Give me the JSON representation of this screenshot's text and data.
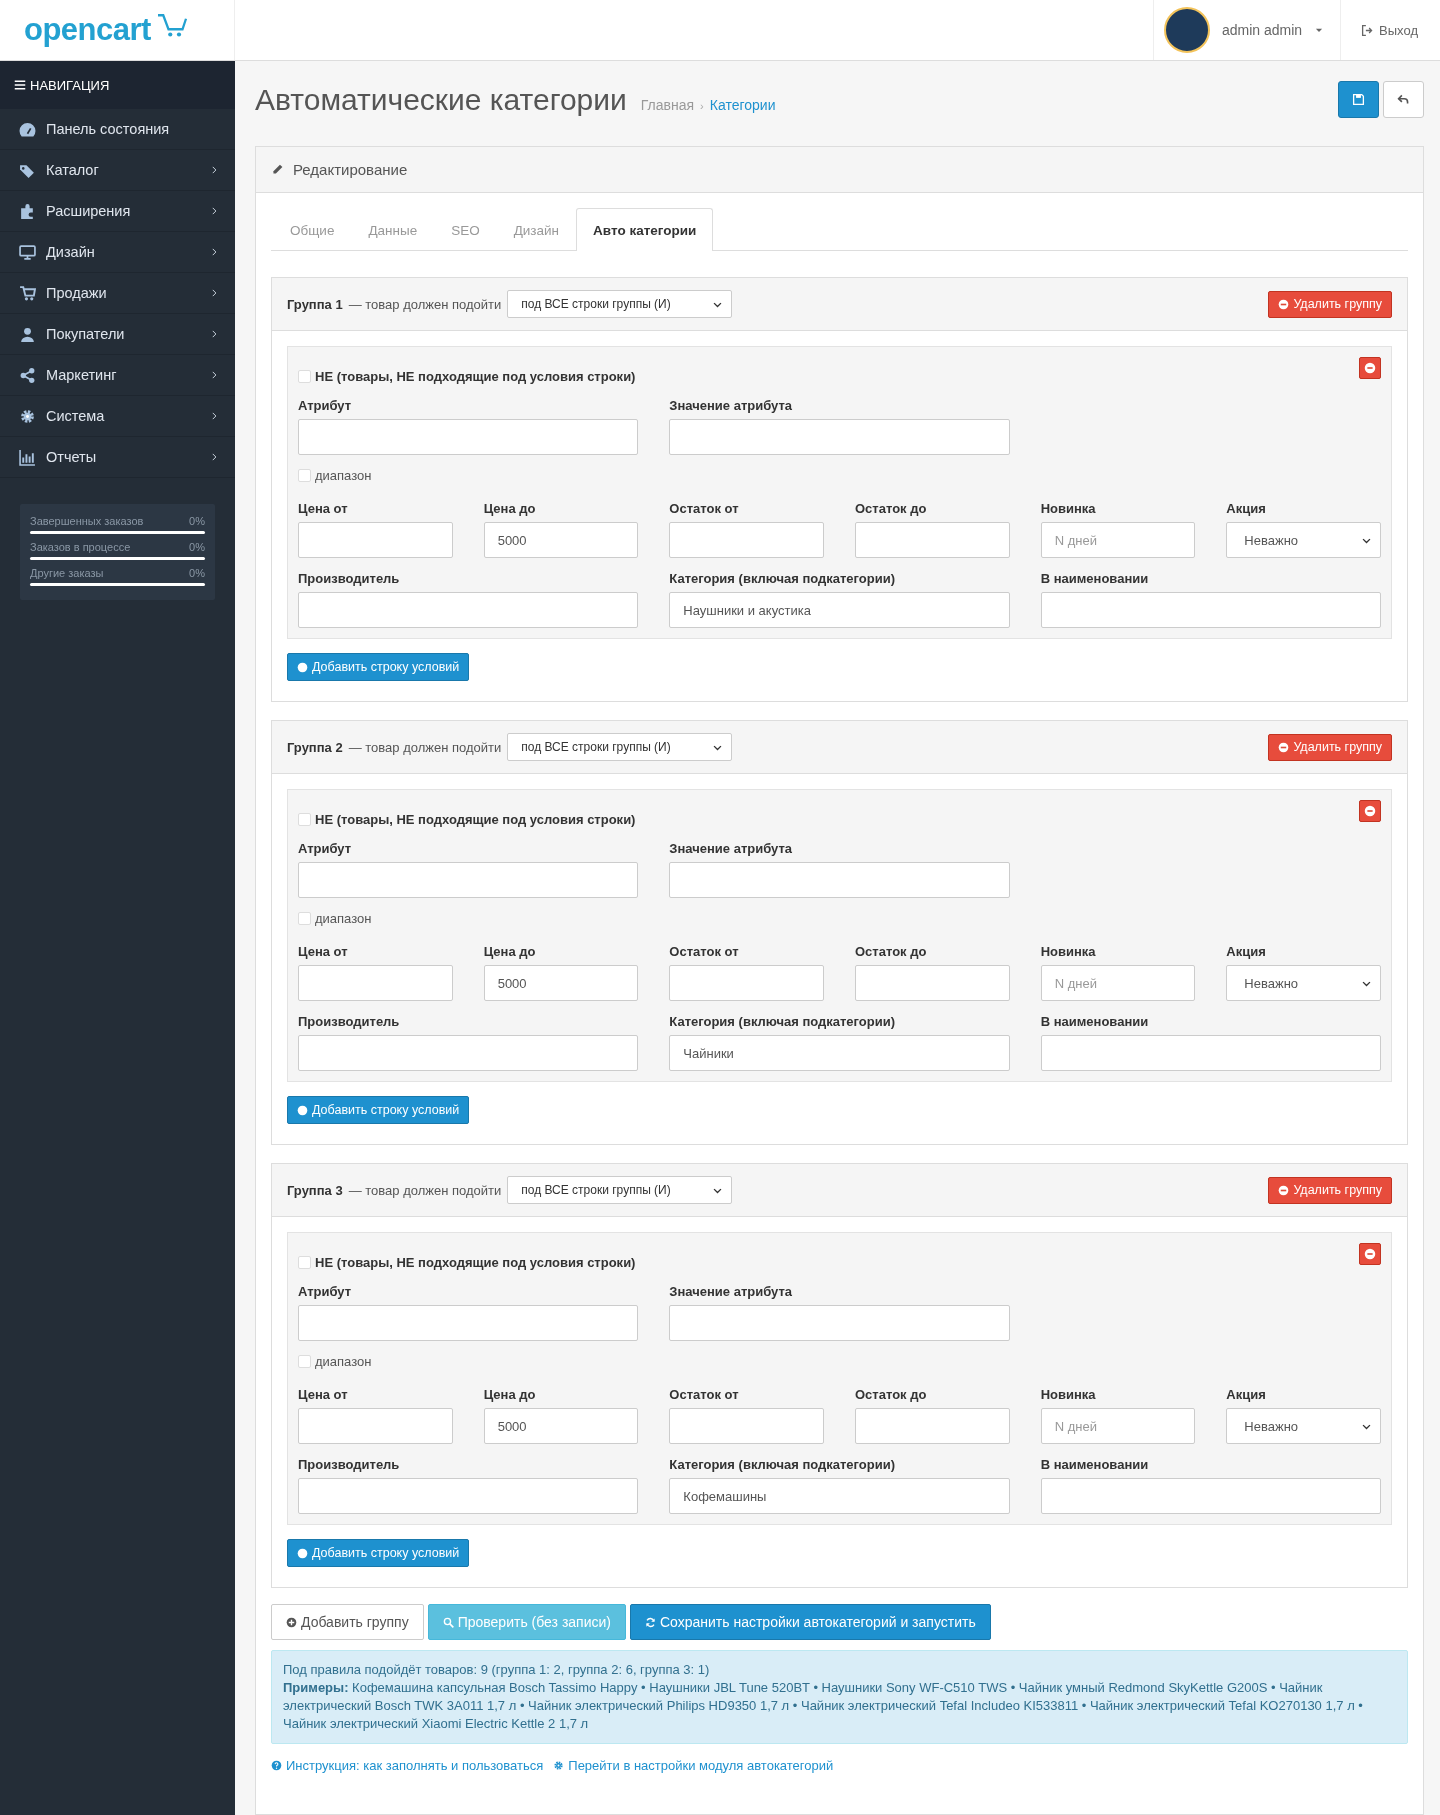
{
  "header": {
    "logo": "opencart",
    "user": "admin admin",
    "logout": "Выход"
  },
  "nav": {
    "title": "НАВИГАЦИЯ",
    "items": [
      {
        "label": "Панель состояния",
        "has_submenu": false
      },
      {
        "label": "Каталог",
        "has_submenu": true
      },
      {
        "label": "Расширения",
        "has_submenu": true
      },
      {
        "label": "Дизайн",
        "has_submenu": true
      },
      {
        "label": "Продажи",
        "has_submenu": true
      },
      {
        "label": "Покупатели",
        "has_submenu": true
      },
      {
        "label": "Маркетинг",
        "has_submenu": true
      },
      {
        "label": "Система",
        "has_submenu": true
      },
      {
        "label": "Отчеты",
        "has_submenu": true
      }
    ],
    "stats": [
      {
        "label": "Завершенных заказов",
        "value": "0%",
        "level": 0
      },
      {
        "label": "Заказов в процессе",
        "value": "0%",
        "level": 0
      },
      {
        "label": "Другие заказы",
        "value": "0%",
        "level": 0
      }
    ]
  },
  "page": {
    "title": "Автоматические категории",
    "separator": "›",
    "breadcrumbs": [
      {
        "label": "Главная",
        "link": false
      },
      {
        "label": "Категории",
        "link": true
      }
    ]
  },
  "panel": {
    "heading": "Редактирование",
    "tabs": [
      {
        "label": "Общие",
        "selected": false
      },
      {
        "label": "Данные",
        "selected": false
      },
      {
        "label": "SEO",
        "selected": false
      },
      {
        "label": "Дизайн",
        "selected": false
      },
      {
        "label": "Авто категории",
        "selected": true
      }
    ]
  },
  "groups": [
    {
      "title": "Группа 1",
      "note": "— товар должен подойти",
      "mode": "под ВСЕ строки группы (И)",
      "delete_label": "Удалить группу",
      "add_row_label": "Добавить строку условий",
      "rows": [
        {
          "negate": {
            "label": "НЕ (товары, НЕ подходящие под условия строки)",
            "checked": false
          },
          "attribute_fields": [
            {
              "kind": "text",
              "label": "Атрибут"
            },
            {
              "kind": "text",
              "label": "Значение атрибута"
            }
          ],
          "range": {
            "label": "диапазон",
            "checked": false
          },
          "filter_fields": [
            {
              "kind": "text",
              "label": "Цена от"
            },
            {
              "kind": "text",
              "label": "Цена до",
              "value": "5000"
            },
            {
              "kind": "text",
              "label": "Остаток от"
            },
            {
              "kind": "text",
              "label": "Остаток до"
            },
            {
              "kind": "text",
              "label": "Новинка",
              "placeholder": "N дней"
            },
            {
              "kind": "select",
              "label": "Акция",
              "value": "Неважно"
            }
          ],
          "detail_fields": [
            {
              "kind": "text",
              "label": "Производитель"
            },
            {
              "kind": "text",
              "label": "Категория (включая подкатегории)",
              "value": "Наушники и акустика"
            },
            {
              "kind": "text",
              "label": "В наименовании"
            }
          ]
        }
      ]
    },
    {
      "title": "Группа 2",
      "note": "— товар должен подойти",
      "mode": "под ВСЕ строки группы (И)",
      "delete_label": "Удалить группу",
      "add_row_label": "Добавить строку условий",
      "rows": [
        {
          "negate": {
            "label": "НЕ (товары, НЕ подходящие под условия строки)",
            "checked": false
          },
          "attribute_fields": [
            {
              "kind": "text",
              "label": "Атрибут"
            },
            {
              "kind": "text",
              "label": "Значение атрибута"
            }
          ],
          "range": {
            "label": "диапазон",
            "checked": false
          },
          "filter_fields": [
            {
              "kind": "text",
              "label": "Цена от"
            },
            {
              "kind": "text",
              "label": "Цена до",
              "value": "5000"
            },
            {
              "kind": "text",
              "label": "Остаток от"
            },
            {
              "kind": "text",
              "label": "Остаток до"
            },
            {
              "kind": "text",
              "label": "Новинка",
              "placeholder": "N дней"
            },
            {
              "kind": "select",
              "label": "Акция",
              "value": "Неважно"
            }
          ],
          "detail_fields": [
            {
              "kind": "text",
              "label": "Производитель"
            },
            {
              "kind": "text",
              "label": "Категория (включая подкатегории)",
              "value": "Чайники"
            },
            {
              "kind": "text",
              "label": "В наименовании"
            }
          ]
        }
      ]
    },
    {
      "title": "Группа 3",
      "note": "— товар должен подойти",
      "mode": "под ВСЕ строки группы (И)",
      "delete_label": "Удалить группу",
      "add_row_label": "Добавить строку условий",
      "rows": [
        {
          "negate": {
            "label": "НЕ (товары, НЕ подходящие под условия строки)",
            "checked": false
          },
          "attribute_fields": [
            {
              "kind": "text",
              "label": "Атрибут"
            },
            {
              "kind": "text",
              "label": "Значение атрибута"
            }
          ],
          "range": {
            "label": "диапазон",
            "checked": false
          },
          "filter_fields": [
            {
              "kind": "text",
              "label": "Цена от"
            },
            {
              "kind": "text",
              "label": "Цена до",
              "value": "5000"
            },
            {
              "kind": "text",
              "label": "Остаток от"
            },
            {
              "kind": "text",
              "label": "Остаток до"
            },
            {
              "kind": "text",
              "label": "Новинка",
              "placeholder": "N дней"
            },
            {
              "kind": "select",
              "label": "Акция",
              "value": "Неважно"
            }
          ],
          "detail_fields": [
            {
              "kind": "text",
              "label": "Производитель"
            },
            {
              "kind": "text",
              "label": "Категория (включая подкатегории)",
              "value": "Кофемашины"
            },
            {
              "kind": "text",
              "label": "В наименовании"
            }
          ]
        }
      ]
    }
  ],
  "actions": [
    {
      "kind": "default",
      "label": "Добавить группу"
    },
    {
      "kind": "info",
      "label": "Проверить (без записи)"
    },
    {
      "kind": "primary",
      "label": "Сохранить настройки автокатегорий и запустить"
    }
  ],
  "summary": {
    "count": "Под правила подойдёт товаров: 9 (группа 1: 2, группа 2: 6, группа 3: 1)",
    "examples": "**Примеры:** Кофемашина капсульная Bosch Tassimo Happy • Наушники JBL Tune 520BT • Наушники Sony WF-C510 TWS • Чайник умный Redmond SkyKettle G200S • Чайник электрический Bosch TWK 3A011 1,7 л • Чайник электрический Philips HD9350 1,7 л • Чайник электрический Tefal Includeo KI533811 • Чайник электрический Tefal KO270130 1,7 л • Чайник электрический Xiaomi Electric Kettle 2 1,7 л"
  },
  "links": [
    {
      "label": "Инструкция: как заполнять и пользоваться"
    },
    {
      "label": "Перейти в настройки модуля автокатегорий"
    }
  ]
}
